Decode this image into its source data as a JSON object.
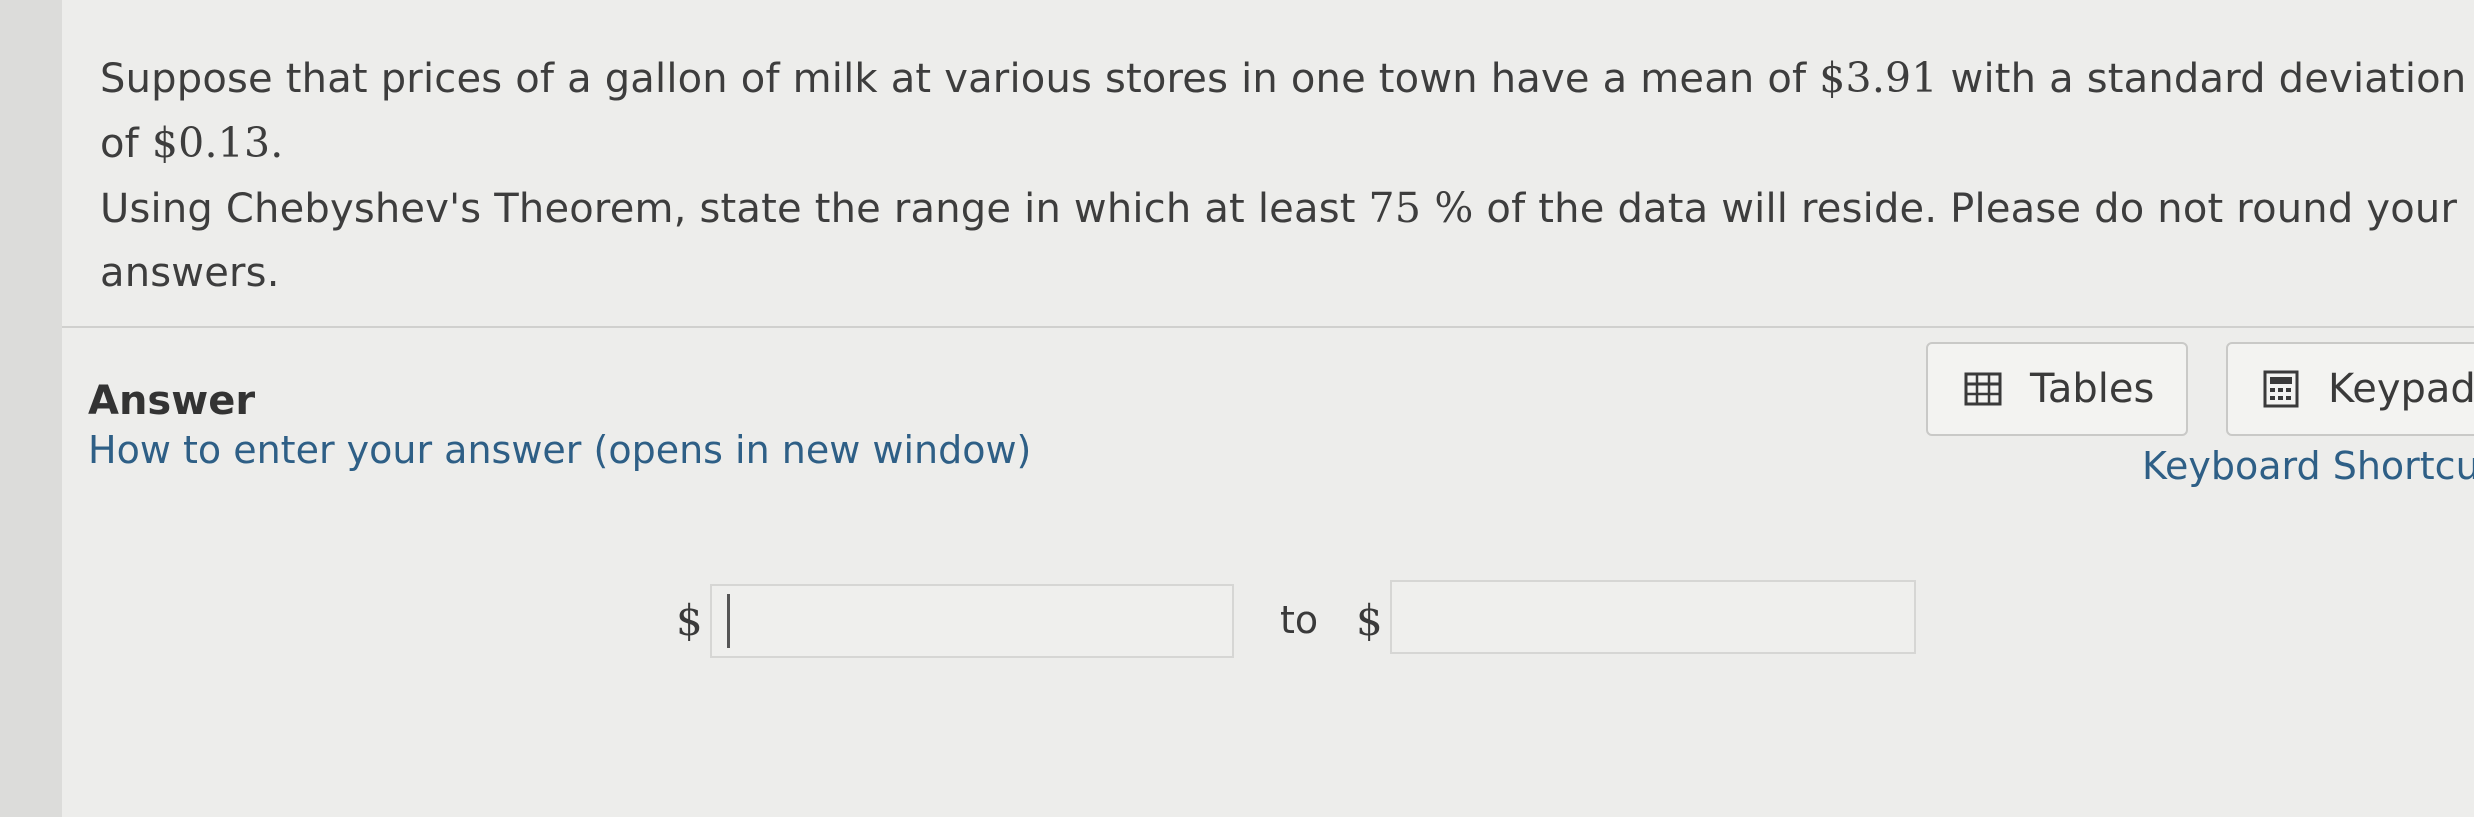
{
  "question": {
    "line1_pre": "Suppose that prices of a gallon of milk at various stores in one town have a mean of ",
    "mean": "$3.91",
    "line1_mid": " with a standard deviation of ",
    "std_dev": "$0.13",
    "line1_end": ".",
    "line2_pre": "Using Chebyshev's Theorem, state the range in which at least ",
    "percent": "75 %",
    "line2_end": " of the data will reside. Please do not round your answers."
  },
  "answer": {
    "label": "Answer",
    "help_link": "How to enter your answer (opens in new window)",
    "lower_prefix": "$",
    "lower_value": "",
    "connector": "to",
    "upper_prefix": "$",
    "upper_value": ""
  },
  "tools": {
    "tables_label": "Tables",
    "tables_icon": "table-grid-icon",
    "keypad_label": "Keypad",
    "keypad_icon": "calculator-icon",
    "keyboard_shortcuts_label": "Keyboard Shortcu"
  }
}
